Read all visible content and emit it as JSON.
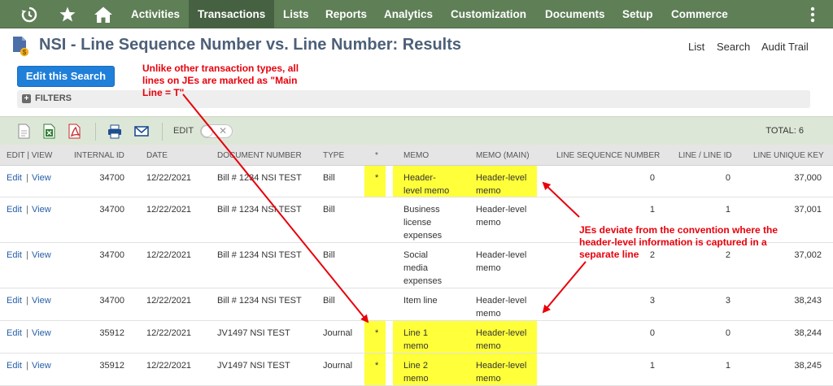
{
  "nav": {
    "items": [
      {
        "label": "Activities"
      },
      {
        "label": "Transactions"
      },
      {
        "label": "Lists"
      },
      {
        "label": "Reports"
      },
      {
        "label": "Analytics"
      },
      {
        "label": "Customization"
      },
      {
        "label": "Documents"
      },
      {
        "label": "Setup"
      },
      {
        "label": "Commerce"
      }
    ],
    "active": "Transactions",
    "icons": [
      "recent-icon",
      "star-icon",
      "home-icon",
      "more-icon"
    ]
  },
  "page": {
    "title": "NSI - Line Sequence Number vs. Line Number: Results",
    "links": [
      "List",
      "Search",
      "Audit Trail"
    ],
    "edit_search_label": "Edit this Search",
    "filters_label": "FILTERS"
  },
  "toolbar": {
    "edit_label": "EDIT",
    "total": "TOTAL: 6",
    "icons": [
      "export-csv-icon",
      "export-excel-icon",
      "export-pdf-icon",
      "print-icon",
      "email-icon"
    ]
  },
  "table": {
    "columns": [
      "EDIT | VIEW",
      "INTERNAL ID",
      "DATE",
      "DOCUMENT NUMBER",
      "TYPE",
      "*",
      "MEMO",
      "MEMO (MAIN)",
      "LINE SEQUENCE NUMBER",
      "LINE / LINE ID",
      "LINE UNIQUE KEY"
    ],
    "edit": "Edit",
    "sep": "|",
    "view": "View",
    "rows": [
      {
        "internal_id": "34700",
        "date": "12/22/2021",
        "doc": "Bill # 1234 NSI TEST",
        "type": "Bill",
        "main": "*",
        "memo": "Header-\nlevel memo",
        "memo_main": "Header-level\nmemo",
        "seq": "0",
        "line": "0",
        "key": "37,000"
      },
      {
        "internal_id": "34700",
        "date": "12/22/2021",
        "doc": "Bill # 1234 NSI TEST",
        "type": "Bill",
        "main": "",
        "memo": "Business\nlicense\nexpenses",
        "memo_main": "Header-level\nmemo",
        "seq": "1",
        "line": "1",
        "key": "37,001"
      },
      {
        "internal_id": "34700",
        "date": "12/22/2021",
        "doc": "Bill # 1234 NSI TEST",
        "type": "Bill",
        "main": "",
        "memo": "Social\nmedia\nexpenses",
        "memo_main": "Header-level\nmemo",
        "seq": "2",
        "line": "2",
        "key": "37,002"
      },
      {
        "internal_id": "34700",
        "date": "12/22/2021",
        "doc": "Bill # 1234 NSI TEST",
        "type": "Bill",
        "main": "",
        "memo": "Item line",
        "memo_main": "Header-level\nmemo",
        "seq": "3",
        "line": "3",
        "key": "38,243"
      },
      {
        "internal_id": "35912",
        "date": "12/22/2021",
        "doc": "JV1497 NSI TEST",
        "type": "Journal",
        "main": "*",
        "memo": "Line 1\nmemo",
        "memo_main": "Header-level\nmemo",
        "seq": "0",
        "line": "0",
        "key": "38,244"
      },
      {
        "internal_id": "35912",
        "date": "12/22/2021",
        "doc": "JV1497 NSI TEST",
        "type": "Journal",
        "main": "*",
        "memo": "Line 2\nmemo",
        "memo_main": "Header-level\nmemo",
        "seq": "1",
        "line": "1",
        "key": "38,245"
      }
    ]
  },
  "annotations": {
    "note_top": "Unlike other transaction types, all\nlines on JEs are marked as \"Main\nLine = T\"",
    "note_right": "JEs deviate from the convention where the\nheader-level information is captured in a\nseparate line",
    "highlight_color": "#ffff3a",
    "arrow_color": "#e8000b"
  }
}
